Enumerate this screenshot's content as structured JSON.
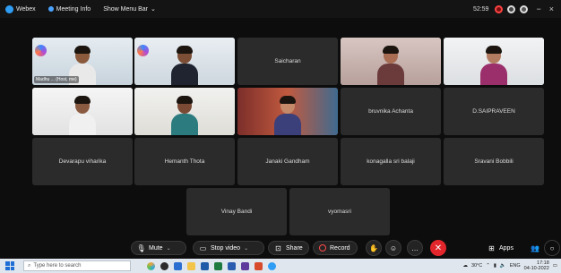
{
  "titlebar": {
    "app_name": "Webex",
    "meeting_info": "Meeting Info",
    "menu_bar": "Show Menu Bar",
    "time": "52:59",
    "minimize": "−",
    "close": "×"
  },
  "participants": [
    {
      "name": "Madhu ... (Host, me)",
      "video": true
    },
    {
      "name": "",
      "video": true
    },
    {
      "name": "Saicharan",
      "video": false
    },
    {
      "name": "",
      "video": true
    },
    {
      "name": "",
      "video": true
    },
    {
      "name": "",
      "video": true
    },
    {
      "name": "",
      "video": true
    },
    {
      "name": "",
      "video": true
    },
    {
      "name": "bruvnika Achanta",
      "video": false
    },
    {
      "name": "D.SAIPRAVEEN",
      "video": false
    },
    {
      "name": "Devarapu viharika",
      "video": false
    },
    {
      "name": "Hemanth Thota",
      "video": false
    },
    {
      "name": "Janaki Gandham",
      "video": false
    },
    {
      "name": "konagalla sri balaji",
      "video": false
    },
    {
      "name": "Sravani Bobbili",
      "video": false
    },
    {
      "name": "Vinay Bandi",
      "video": false
    },
    {
      "name": "vyomasri",
      "video": false
    }
  ],
  "controls": {
    "mute": "Mute",
    "stop_video": "Stop video",
    "share": "Share",
    "record": "Record",
    "apps": "Apps"
  },
  "taskbar": {
    "search_placeholder": "Type here to search",
    "temperature": "30°C",
    "language": "ENG",
    "time": "17:18",
    "date": "04-10-2022"
  }
}
